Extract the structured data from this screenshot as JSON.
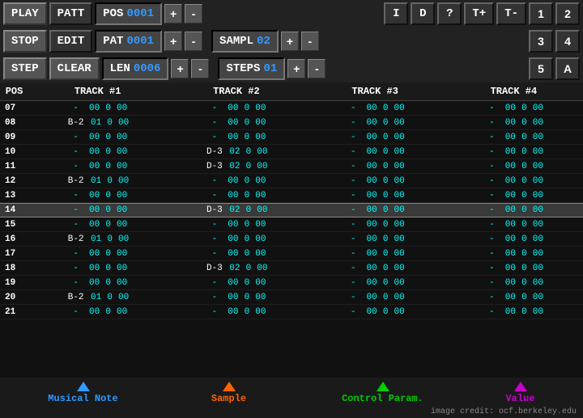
{
  "header": {
    "row1": {
      "play_label": "PLAY",
      "patt_label": "PATT",
      "pos_label": "POS",
      "pos_value": "0001",
      "plus": "+",
      "minus": "-",
      "i_label": "I",
      "d_label": "D",
      "q_label": "?",
      "tplus_label": "T+",
      "tminus_label": "T-",
      "n1_label": "1",
      "n2_label": "2"
    },
    "row2": {
      "stop_label": "STOP",
      "edit_label": "EDIT",
      "pat_label": "PAT",
      "pat_value": "0001",
      "plus": "+",
      "minus": "-",
      "sampl_label": "SAMPL",
      "sampl_value": "02",
      "plus2": "+",
      "minus2": "-",
      "n3_label": "3",
      "n4_label": "4"
    },
    "row3": {
      "step_label": "STEP",
      "clear_label": "CLEAR",
      "len_label": "LEN",
      "len_value": "0006",
      "plus": "+",
      "minus": "-",
      "steps_label": "STEPS",
      "steps_value": "01",
      "plus2": "+",
      "minus2": "-",
      "n5_label": "5",
      "na_label": "A"
    }
  },
  "sequencer": {
    "headers": [
      "POS",
      "TRACK #1",
      "TRACK #2",
      "TRACK #3",
      "TRACK #4"
    ],
    "rows": [
      {
        "pos": "07",
        "t1": "- 00 0 00",
        "t2": "- 00 0 00",
        "t3": "- 00 0 00",
        "t4": "- 00 0 00",
        "highlight": false,
        "active": false
      },
      {
        "pos": "08",
        "t1": "B-2 01 0 00",
        "t2": "- 00 0 00",
        "t3": "- 00 0 00",
        "t4": "- 00 0 00",
        "highlight": false,
        "active": false
      },
      {
        "pos": "09",
        "t1": "- 00 0 00",
        "t2": "- 00 0 00",
        "t3": "- 00 0 00",
        "t4": "- 00 0 00",
        "highlight": false,
        "active": false
      },
      {
        "pos": "10",
        "t1": "- 00 0 00",
        "t2": "D-3 02 0 00",
        "t3": "- 00 0 00",
        "t4": "- 00 0 00",
        "highlight": false,
        "active": false
      },
      {
        "pos": "11",
        "t1": "- 00 0 00",
        "t2": "D-3 02 0 00",
        "t3": "- 00 0 00",
        "t4": "- 00 0 00",
        "highlight": false,
        "active": false
      },
      {
        "pos": "12",
        "t1": "B-2 01 0 00",
        "t2": "- 00 0 00",
        "t3": "- 00 0 00",
        "t4": "- 00 0 00",
        "highlight": false,
        "active": false
      },
      {
        "pos": "13",
        "t1": "- 00 0 00",
        "t2": "- 00 0 00",
        "t3": "- 00 0 00",
        "t4": "- 00 0 00",
        "highlight": false,
        "active": false
      },
      {
        "pos": "14",
        "t1": "- 00 0 00",
        "t2": "D-3 02 0 00",
        "t3": "- 00 0 00",
        "t4": "- 00 0 00",
        "highlight": true,
        "active": false
      },
      {
        "pos": "15",
        "t1": "- 00 0 00",
        "t2": "- 00 0 00",
        "t3": "- 00 0 00",
        "t4": "- 00 0 00",
        "highlight": false,
        "active": false
      },
      {
        "pos": "16",
        "t1": "B-2 01 0 00",
        "t2": "- 00 0 00",
        "t3": "- 00 0 00",
        "t4": "- 00 0 00",
        "highlight": false,
        "active": false
      },
      {
        "pos": "17",
        "t1": "- 00 0 00",
        "t2": "- 00 0 00",
        "t3": "- 00 0 00",
        "t4": "- 00 0 00",
        "highlight": false,
        "active": false
      },
      {
        "pos": "18",
        "t1": "- 00 0 00",
        "t2": "D-3 02 0 00",
        "t3": "- 00 0 00",
        "t4": "- 00 0 00",
        "highlight": false,
        "active": false
      },
      {
        "pos": "19",
        "t1": "- 00 0 00",
        "t2": "- 00 0 00",
        "t3": "- 00 0 00",
        "t4": "- 00 0 00",
        "highlight": false,
        "active": false
      },
      {
        "pos": "20",
        "t1": "B-2 01 0 00",
        "t2": "- 00 0 00",
        "t3": "- 00 0 00",
        "t4": "- 00 0 00",
        "highlight": false,
        "active": false
      },
      {
        "pos": "21",
        "t1": "- 00 0 00",
        "t2": "- 00 0 00",
        "t3": "- 00 0 00",
        "t4": "- 00 0 00",
        "highlight": false,
        "active": false
      }
    ]
  },
  "annotations": [
    {
      "label": "Musical  Note",
      "color": "#3399ff"
    },
    {
      "label": "Sample",
      "color": "#ff6600"
    },
    {
      "label": "Control Param.",
      "color": "#00cc00"
    },
    {
      "label": "Value",
      "color": "#cc00cc"
    }
  ],
  "credit": "image credit: ocf.berkeley.edu"
}
